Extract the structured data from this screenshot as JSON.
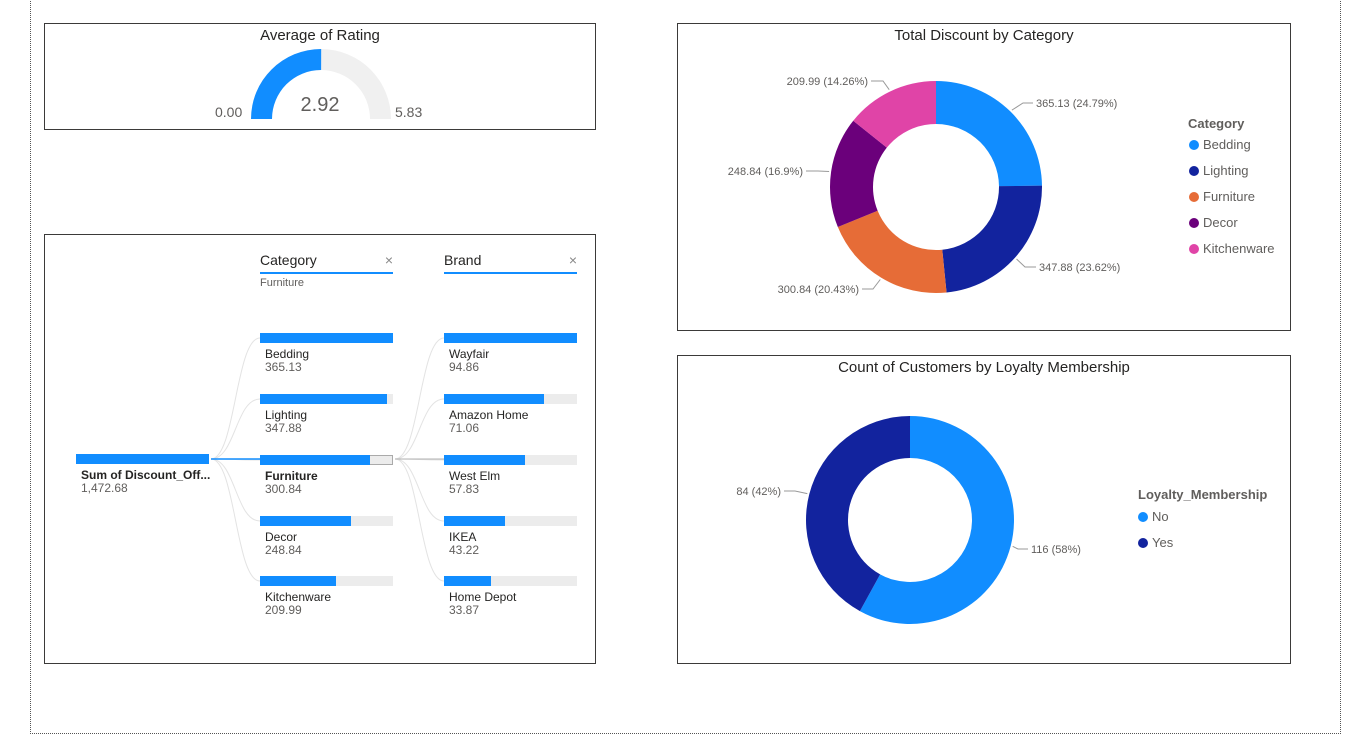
{
  "gauge": {
    "title": "Average of Rating",
    "min_label": "0.00",
    "max_label": "5.83",
    "value_label": "2.92",
    "value_fraction": 0.5008,
    "fill_color": "#118dff",
    "track_color": "#f0f0f0"
  },
  "decomp_tree": {
    "root": {
      "label": "Sum of Discount_Off...",
      "value": "1,472.68"
    },
    "category_header": "Category",
    "category_selected": "Furniture",
    "brand_header": "Brand",
    "close_glyph": "×",
    "categories": [
      {
        "label": "Bedding",
        "value": "365.13",
        "fraction": 1.0
      },
      {
        "label": "Lighting",
        "value": "347.88",
        "fraction": 0.953
      },
      {
        "label": "Furniture",
        "value": "300.84",
        "fraction": 0.824
      },
      {
        "label": "Decor",
        "value": "248.84",
        "fraction": 0.681
      },
      {
        "label": "Kitchenware",
        "value": "209.99",
        "fraction": 0.575
      }
    ],
    "brands": [
      {
        "label": "Wayfair",
        "value": "94.86",
        "fraction": 1.0
      },
      {
        "label": "Amazon Home",
        "value": "71.06",
        "fraction": 0.749
      },
      {
        "label": "West Elm",
        "value": "57.83",
        "fraction": 0.61
      },
      {
        "label": "IKEA",
        "value": "43.22",
        "fraction": 0.456
      },
      {
        "label": "Home Depot",
        "value": "33.87",
        "fraction": 0.357
      }
    ]
  },
  "chart_data": [
    {
      "type": "pie",
      "title": "Total Discount by Category",
      "legend_title": "Category",
      "legend_position": "right",
      "categories": [
        "Bedding",
        "Lighting",
        "Furniture",
        "Decor",
        "Kitchenware"
      ],
      "values": [
        365.13,
        347.88,
        300.84,
        248.84,
        209.99
      ],
      "data_labels": [
        "365.13 (24.79%)",
        "347.88 (23.62%)",
        "300.84 (20.43%)",
        "248.84 (16.9%)",
        "209.99 (14.26%)"
      ],
      "colors": [
        "#118dff",
        "#12239e",
        "#e66c37",
        "#6b007b",
        "#e044a7"
      ]
    },
    {
      "type": "pie",
      "title": "Count of Customers by Loyalty Membership",
      "legend_title": "Loyalty_Membership",
      "legend_position": "right",
      "categories": [
        "No",
        "Yes"
      ],
      "values": [
        116,
        84
      ],
      "data_labels": [
        "116 (58%)",
        "84 (42%)"
      ],
      "colors": [
        "#118dff",
        "#12239e"
      ]
    }
  ]
}
